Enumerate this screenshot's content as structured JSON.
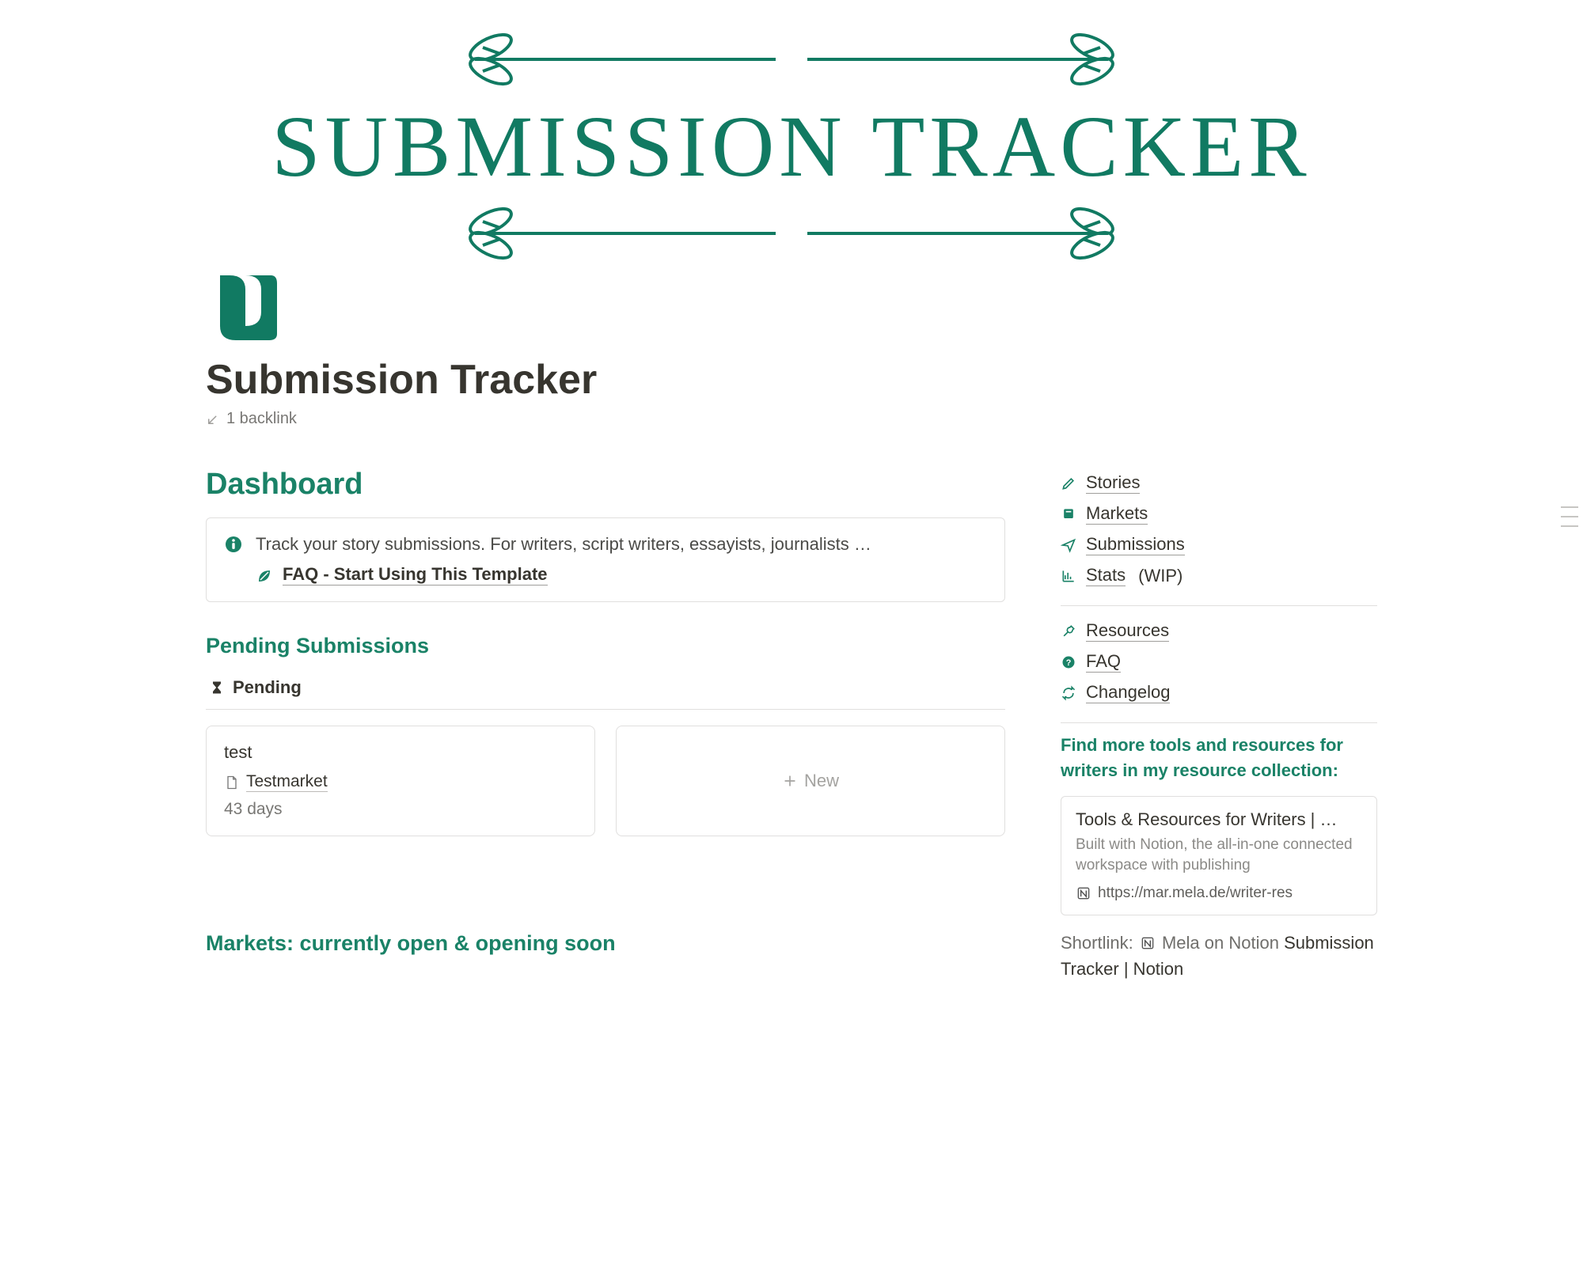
{
  "hero": {
    "title": "SUBMISSION TRACKER"
  },
  "page": {
    "title": "Submission Tracker",
    "backlinks": "1 backlink"
  },
  "dashboard": {
    "heading": "Dashboard",
    "callout_text": "Track your story submissions. For writers, script writers, essayists, journalists …",
    "faq_label": "FAQ - Start Using This Template"
  },
  "pending": {
    "heading": "Pending Submissions",
    "view_label": "Pending",
    "cards": [
      {
        "title": "test",
        "market": "Testmarket",
        "days": "43 days"
      }
    ],
    "new_label": "New"
  },
  "markets_section": {
    "heading": "Markets: currently open & opening soon"
  },
  "sidebar": {
    "group1": [
      {
        "icon": "pencil",
        "label": "Stories"
      },
      {
        "icon": "bookmark",
        "label": "Markets"
      },
      {
        "icon": "send",
        "label": "Submissions"
      },
      {
        "icon": "chart",
        "label": "Stats",
        "suffix": "(WIP)"
      }
    ],
    "group2": [
      {
        "icon": "wrench",
        "label": "Resources"
      },
      {
        "icon": "question",
        "label": "FAQ"
      },
      {
        "icon": "refresh",
        "label": "Changelog"
      }
    ],
    "note": "Find more tools and resources for writers in my resource collection:",
    "bookmark": {
      "title": "Tools & Resources for Writers | …",
      "desc": "Built with Notion, the all-in-one connected workspace with publishing",
      "url": "https://mar.mela.de/writer-res"
    },
    "shortlink": {
      "prefix": "Shortlink:",
      "text1": "Mela on Notion",
      "text2": "Submission Tracker | Notion"
    }
  }
}
